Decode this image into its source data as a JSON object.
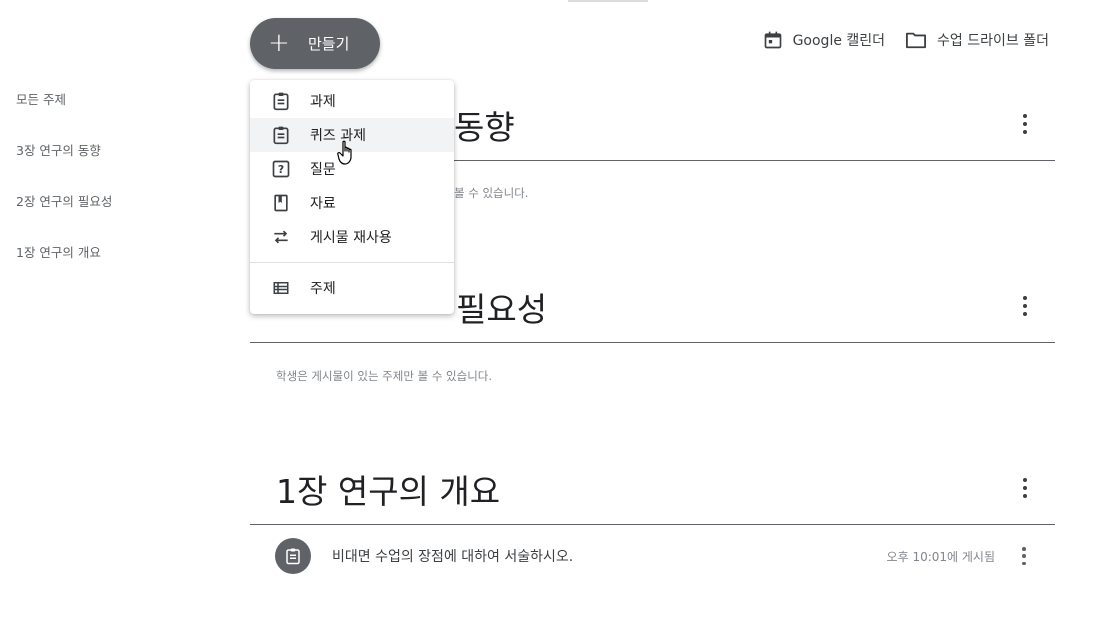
{
  "header": {
    "create_label": "만들기",
    "calendar_label": "Google 캘린더",
    "drive_label": "수업 드라이브 폴더"
  },
  "sidebar": {
    "items": [
      {
        "label": "모든 주제"
      },
      {
        "label": "3장 연구의 동향"
      },
      {
        "label": "2장 연구의 필요성"
      },
      {
        "label": "1장 연구의 개요"
      }
    ]
  },
  "menu": {
    "items": [
      {
        "label": "과제",
        "icon": "assignment-icon"
      },
      {
        "label": "퀴즈 과제",
        "icon": "quiz-assignment-icon"
      },
      {
        "label": "질문",
        "icon": "question-icon"
      },
      {
        "label": "자료",
        "icon": "material-icon"
      },
      {
        "label": "게시물 재사용",
        "icon": "reuse-post-icon"
      }
    ],
    "topic_item": {
      "label": "주제",
      "icon": "topic-icon"
    }
  },
  "topics": [
    {
      "title_visible": "동향",
      "note_visible": "볼 수 있습니다."
    },
    {
      "title_visible": "필요성",
      "note": "학생은 게시물이 있는 주제만 볼 수 있습니다."
    },
    {
      "title": "1장 연구의 개요",
      "posts": [
        {
          "title": "비대면 수업의 장점에 대하여 서술하시오.",
          "time": "오후 10:01에 게시됨"
        }
      ]
    }
  ],
  "colors": {
    "button_bg": "#5f6368",
    "menu_hover": "#f1f3f4",
    "text_primary": "#202124",
    "text_secondary": "#5f6368"
  }
}
